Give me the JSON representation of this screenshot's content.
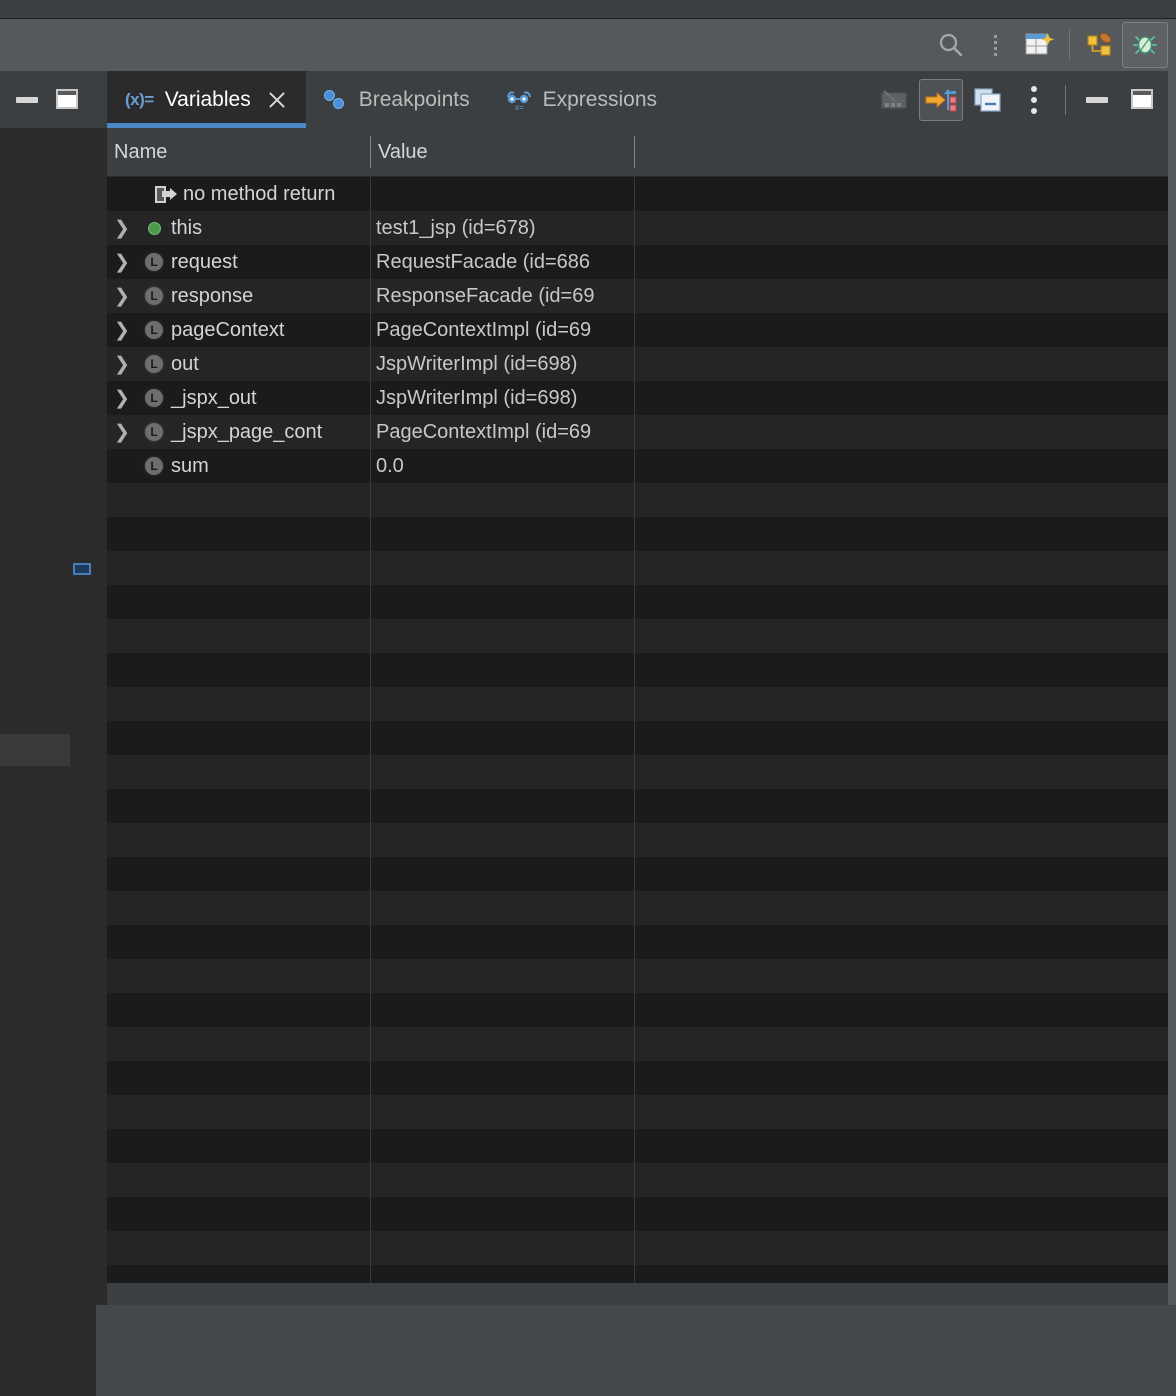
{
  "window": {
    "theme_bg": "#2b2b2b",
    "header_bg": "#55595b",
    "accent": "#4a88c7"
  },
  "header": {
    "icons": [
      {
        "name": "search-icon",
        "label": "Search"
      },
      {
        "name": "grip-dots-icon",
        "label": "Drag handle"
      },
      {
        "name": "layout-settings-icon",
        "label": "Layout Settings"
      },
      {
        "name": "run-configurations-icon",
        "label": "Run Configurations"
      },
      {
        "name": "debug-icon",
        "label": "Debug",
        "selected": true
      }
    ]
  },
  "left_rail": {
    "buttons": [
      {
        "name": "minimize-button",
        "label": "Minimize"
      },
      {
        "name": "maximize-button",
        "label": "Maximize"
      }
    ]
  },
  "tabs": [
    {
      "id": "variables",
      "label": "Variables",
      "icon": "(x)=",
      "icon_name": "variables-icon",
      "active": true,
      "closable": true
    },
    {
      "id": "breakpoints",
      "label": "Breakpoints",
      "icon_name": "breakpoints-icon",
      "active": false,
      "closable": false
    },
    {
      "id": "expressions",
      "label": "Expressions",
      "icon_name": "expressions-icon",
      "active": false,
      "closable": false
    }
  ],
  "toolbar": [
    {
      "name": "mute-breakpoints-button",
      "label": "Mute Breakpoints",
      "state": "disabled"
    },
    {
      "name": "evaluate-expression-button",
      "label": "Evaluate Expression",
      "state": "selected"
    },
    {
      "name": "show-frames-button",
      "label": "Show Frames",
      "state": "normal"
    },
    {
      "name": "more-options-button",
      "label": "More Options",
      "state": "normal"
    },
    {
      "name": "hide-button",
      "label": "Hide",
      "state": "normal"
    },
    {
      "name": "restore-button",
      "label": "Restore Layout",
      "state": "normal"
    }
  ],
  "table": {
    "columns": [
      "Name",
      "Value"
    ],
    "rows": [
      {
        "name": "no method return",
        "value": "",
        "icon": "return",
        "expandable": false
      },
      {
        "name": "this",
        "value": "test1_jsp  (id=678)",
        "icon": "this",
        "expandable": true
      },
      {
        "name": "request",
        "value": "RequestFacade  (id=686",
        "icon": "local",
        "expandable": true
      },
      {
        "name": "response",
        "value": "ResponseFacade  (id=69",
        "icon": "local",
        "expandable": true
      },
      {
        "name": "pageContext",
        "value": "PageContextImpl  (id=69",
        "icon": "local",
        "expandable": true
      },
      {
        "name": "out",
        "value": "JspWriterImpl  (id=698)",
        "icon": "local",
        "expandable": true
      },
      {
        "name": "_jspx_out",
        "value": "JspWriterImpl  (id=698)",
        "icon": "local",
        "expandable": true
      },
      {
        "name": "_jspx_page_cont",
        "value": "PageContextImpl  (id=69",
        "icon": "local",
        "expandable": true
      },
      {
        "name": "sum",
        "value": "0.0",
        "icon": "local",
        "expandable": false
      }
    ],
    "local_icon_letter": "L",
    "empty_row_count": 25
  }
}
